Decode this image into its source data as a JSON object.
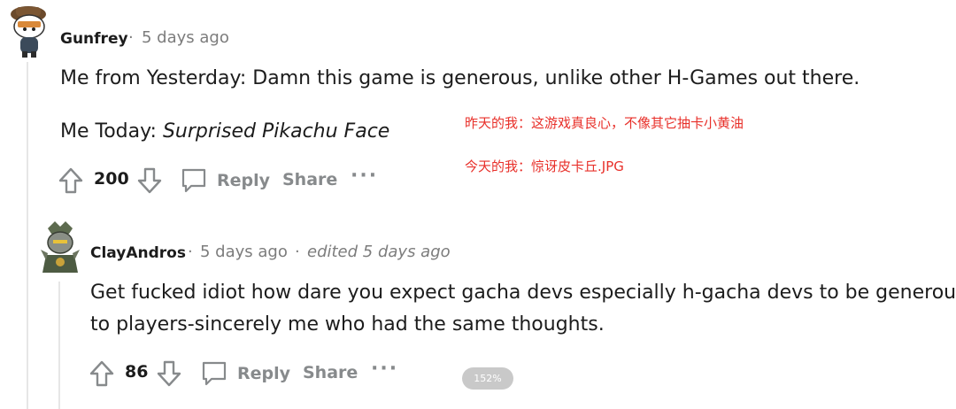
{
  "comments": [
    {
      "author": "Gunfrey",
      "separator": "·",
      "time": "5 days ago",
      "lines": [
        {
          "text": "Me from Yesterday: Damn this game is generous, unlike other H-Games out there."
        },
        {
          "prefix": "Me Today: ",
          "italic": "Surprised Pikachu Face"
        }
      ],
      "score": "200",
      "reply_label": "Reply",
      "share_label": "Share",
      "more_label": "···"
    },
    {
      "author": "ClayAndros",
      "separator": "·",
      "time": "5 days ago",
      "edited_separator": "·",
      "edited": "edited 5 days ago",
      "lines": [
        {
          "text": "Get fucked idiot how dare you expect gacha devs especially h-gacha devs to be generous"
        },
        {
          "text": "to players-sincerely me who had the same thoughts."
        }
      ],
      "score": "86",
      "reply_label": "Reply",
      "share_label": "Share",
      "more_label": "···"
    }
  ],
  "annotations": [
    "昨天的我：这游戏真良心，不像其它抽卡小黄油",
    "今天的我：惊讶皮卡丘.JPG"
  ],
  "zoom_level": "152%",
  "colors": {
    "annotation": "#e8302a",
    "meta": "#7c7c7c",
    "action": "#878a8c"
  },
  "icons": [
    "upvote-icon",
    "downvote-icon",
    "comment-icon"
  ]
}
